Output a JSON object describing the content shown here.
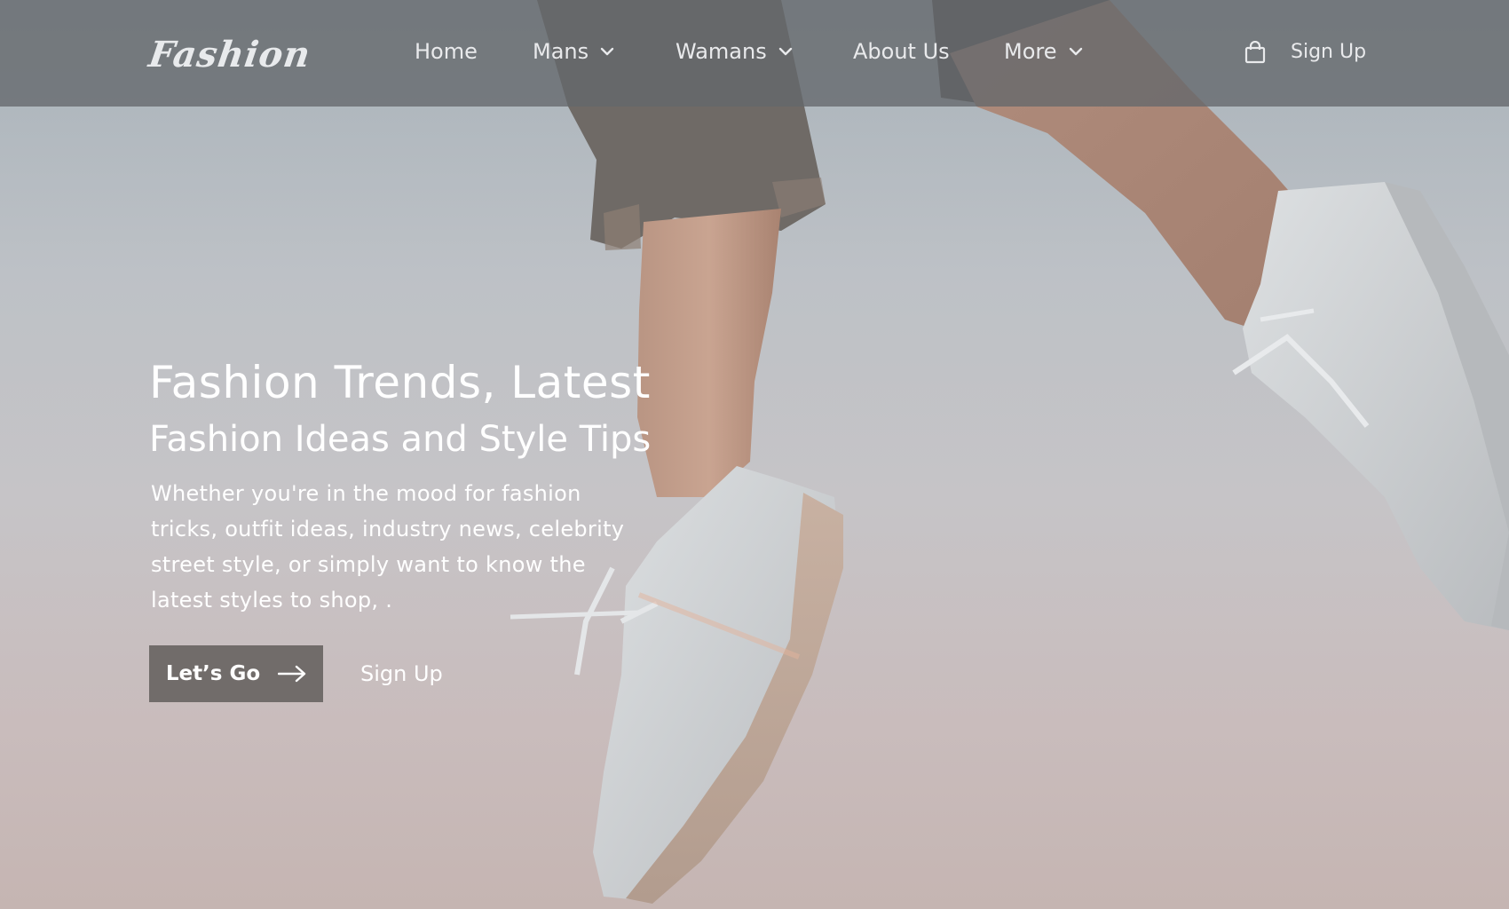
{
  "brand": {
    "logo_text": "Fashion"
  },
  "nav": {
    "items": [
      {
        "label": "Home",
        "dropdown": false
      },
      {
        "label": "Mans",
        "dropdown": true
      },
      {
        "label": "Wamans",
        "dropdown": true
      },
      {
        "label": "About Us",
        "dropdown": false
      },
      {
        "label": "More",
        "dropdown": true
      }
    ],
    "cart_icon": "shopping-bag-icon",
    "signup_label": "Sign Up"
  },
  "hero": {
    "title": "Fashion Trends, Latest",
    "subtitle": "Fashion Ideas and Style Tips",
    "description": "Whether you're in the mood for fashion tricks, outfit ideas, industry news, celebrity street style, or simply want to know the latest styles to shop, .",
    "primary_button_label": "Let’s Go",
    "primary_button_icon": "arrow-right-icon",
    "secondary_link_label": "Sign Up"
  },
  "colors": {
    "navbar_bg": "#64686c",
    "button_bg": "#716c6a",
    "text": "#ffffff"
  }
}
